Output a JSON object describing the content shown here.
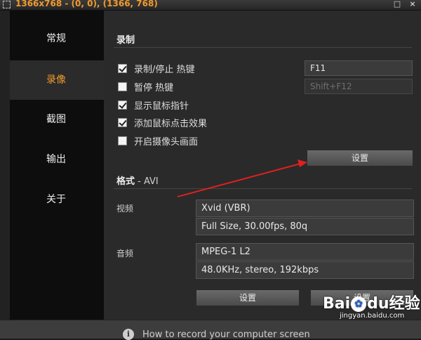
{
  "titlebar": {
    "title": "1366x768 - (0, 0), (1366, 768)",
    "restore_glyph": "□",
    "close_glyph": "×"
  },
  "sidebar": {
    "items": [
      {
        "label": "常规",
        "active": false
      },
      {
        "label": "录像",
        "active": true
      },
      {
        "label": "截图",
        "active": false
      },
      {
        "label": "输出",
        "active": false
      },
      {
        "label": "关于",
        "active": false
      }
    ]
  },
  "record": {
    "section_title": "录制",
    "options": [
      {
        "label": "录制/停止 热键",
        "checked": true
      },
      {
        "label": "暂停 热键",
        "checked": false
      },
      {
        "label": "显示鼠标指针",
        "checked": true
      },
      {
        "label": "添加鼠标点击效果",
        "checked": true
      },
      {
        "label": "开启摄像头画面",
        "checked": false
      }
    ],
    "hotkey_record_value": "F11",
    "hotkey_pause_value": "Shift+F12",
    "settings_button": "设置"
  },
  "format": {
    "section_title": "格式",
    "section_sub": " - AVI",
    "video_label": "视频",
    "video_codec": "Xvid (VBR)",
    "video_detail": "Full Size, 30.00fps, 80q",
    "audio_label": "音频",
    "audio_codec": "MPEG-1 L2",
    "audio_detail": "48.0KHz, stereo, 192kbps",
    "settings_button": "设置",
    "second_button": "设置"
  },
  "status": {
    "info_glyph": "i",
    "help_text": "How to record your computer screen"
  },
  "watermark": {
    "brand_left": "Bai",
    "brand_mid": "du",
    "brand_right": "经验",
    "url": "jingyan.baidu.com"
  },
  "colors": {
    "accent": "#f09a2d",
    "arrow": "#e02020"
  }
}
